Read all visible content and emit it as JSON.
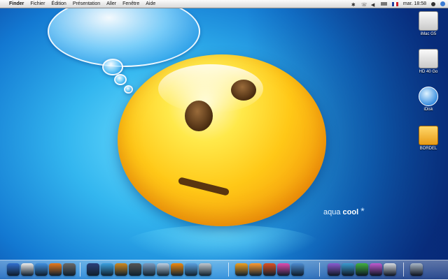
{
  "menubar": {
    "apple": "",
    "items": [
      "Finder",
      "Fichier",
      "Édition",
      "Présentation",
      "Aller",
      "Fenêtre",
      "Aide"
    ],
    "clock": "mar. 18:58"
  },
  "brand": {
    "light": "aqua",
    "bold": "cool",
    "star": "*"
  },
  "desktop_icons": [
    {
      "label": "iMac G5",
      "icon": "hard-drive-icon"
    },
    {
      "label": "HD 40 Go",
      "icon": "hard-drive-icon"
    },
    {
      "label": "iDisk",
      "icon": "idisk-icon"
    },
    {
      "label": "BORDEL",
      "icon": "folder-icon"
    }
  ],
  "dock_apps": [
    {
      "name": "finder",
      "color": "#2f6fd0"
    },
    {
      "name": "clock",
      "color": "#eeeeee"
    },
    {
      "name": "safari",
      "color": "#3f8fe0"
    },
    {
      "name": "firefox",
      "color": "#e87a1d"
    },
    {
      "name": "script",
      "color": "#6a6a6a"
    },
    {
      "name": "photo",
      "color": "#2a3f7a"
    },
    {
      "name": "itunes",
      "color": "#3aa0e0"
    },
    {
      "name": "imovie",
      "color": "#d08a20"
    },
    {
      "name": "idvd",
      "color": "#555555"
    },
    {
      "name": "iphoto",
      "color": "#7a9ac0"
    },
    {
      "name": "quicktime",
      "color": "#bcd0e4"
    },
    {
      "name": "vlc",
      "color": "#f08a10"
    },
    {
      "name": "photoshop",
      "color": "#5aa0e0"
    },
    {
      "name": "mail",
      "color": "#c0c8d0"
    },
    {
      "name": "flower",
      "color": "#f0a020"
    },
    {
      "name": "daisy",
      "color": "#ff9a30"
    },
    {
      "name": "feather",
      "color": "#e05020"
    },
    {
      "name": "butterfly",
      "color": "#e04ab0"
    },
    {
      "name": "app-blue",
      "color": "#4a8ad0"
    },
    {
      "name": "w-letter",
      "color": "#8a5ad0"
    },
    {
      "name": "p-letter",
      "color": "#3a9ad0"
    },
    {
      "name": "msn",
      "color": "#40b040"
    },
    {
      "name": "e-letter",
      "color": "#c05ad0"
    },
    {
      "name": "downloads",
      "color": "#d8dde4"
    },
    {
      "name": "trash",
      "color": "#aab8c8"
    }
  ]
}
